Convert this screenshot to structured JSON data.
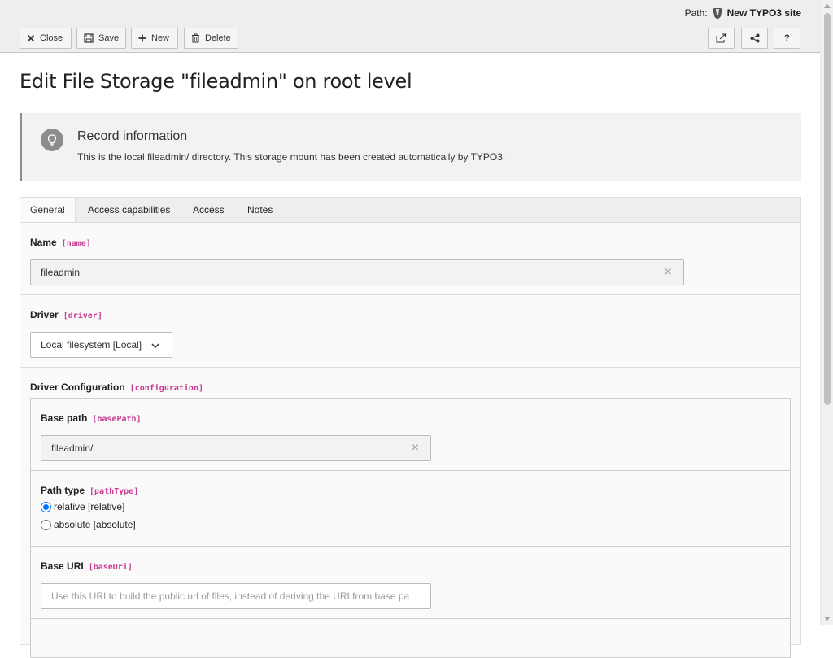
{
  "docheader": {
    "path_label": "Path:",
    "site_title": "New TYPO3 site",
    "buttons": {
      "close": "Close",
      "save": "Save",
      "new": "New",
      "delete": "Delete",
      "help": "?"
    }
  },
  "page": {
    "title": "Edit File Storage \"fileadmin\" on root level"
  },
  "callout": {
    "title": "Record information",
    "text": "This is the local fileadmin/ directory. This storage mount has been created automatically by TYPO3."
  },
  "tabs": [
    {
      "label": "General",
      "active": true
    },
    {
      "label": "Access capabilities",
      "active": false
    },
    {
      "label": "Access",
      "active": false
    },
    {
      "label": "Notes",
      "active": false
    }
  ],
  "form": {
    "name": {
      "label": "Name",
      "code": "[name]",
      "value": "fileadmin",
      "clear": "×"
    },
    "driver": {
      "label": "Driver",
      "code": "[driver]",
      "selected": "Local filesystem [Local]"
    },
    "driver_config": {
      "label": "Driver Configuration",
      "code": "[configuration]"
    },
    "base_path": {
      "label": "Base path",
      "code": "[basePath]",
      "value": "fileadmin/",
      "clear": "×"
    },
    "path_type": {
      "label": "Path type",
      "code": "[pathType]",
      "options": [
        {
          "label": "relative [relative]",
          "checked": true
        },
        {
          "label": "absolute [absolute]",
          "checked": false
        }
      ]
    },
    "base_uri": {
      "label": "Base URI",
      "code": "[baseUri]",
      "placeholder": "Use this URI to build the public url of files, instead of deriving the URI from base pa"
    }
  },
  "colors": {
    "accent_code": "#c83c91",
    "header_bg": "#eeeeee",
    "radio_checked": "#0075ff"
  }
}
